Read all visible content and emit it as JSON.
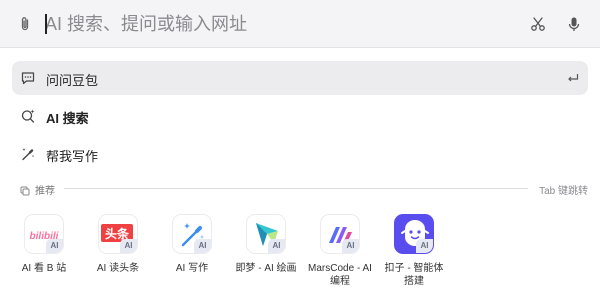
{
  "search": {
    "ai_prefix": "AI",
    "placeholder": "AI 搜索、提问或输入网址",
    "value": ""
  },
  "icons": {
    "attach": "paperclip-icon",
    "screenshot": "scissors-icon",
    "voice": "microphone-icon",
    "enter": "enter-icon"
  },
  "menu": {
    "items": [
      {
        "label": "问问豆包",
        "icon": "chat-icon",
        "active": true
      },
      {
        "label": "AI 搜索",
        "icon": "ai-search-icon",
        "active": false
      },
      {
        "label": "帮我写作",
        "icon": "magic-pen-icon",
        "active": false
      }
    ]
  },
  "recommend": {
    "title": "推荐",
    "hint": "Tab 键跳转",
    "badge": "AI",
    "apps": [
      {
        "label": "AI 看 B 站",
        "icon": "bilibili-icon",
        "tile_text": "bilibili",
        "color": "#fb7299"
      },
      {
        "label": "AI 读头条",
        "icon": "toutiao-icon",
        "tile_text": "头条",
        "color": "#f04142"
      },
      {
        "label": "AI 写作",
        "icon": "magic-wand-icon",
        "color": "#3a8ff0"
      },
      {
        "label": "即梦 - AI 绘画",
        "icon": "jimeng-icon",
        "color": "#36c6d0"
      },
      {
        "label": "MarsCode - AI 编程",
        "icon": "marscode-icon",
        "color": "#6a5cf6"
      },
      {
        "label": "扣子 - 智能体搭建",
        "icon": "coze-icon",
        "color": "#5a4df0"
      }
    ]
  },
  "colors": {
    "topbar_bg": "#f4f4f6",
    "active_row_bg": "#ececee",
    "text_primary": "#222222",
    "text_muted": "#8a8a90"
  }
}
